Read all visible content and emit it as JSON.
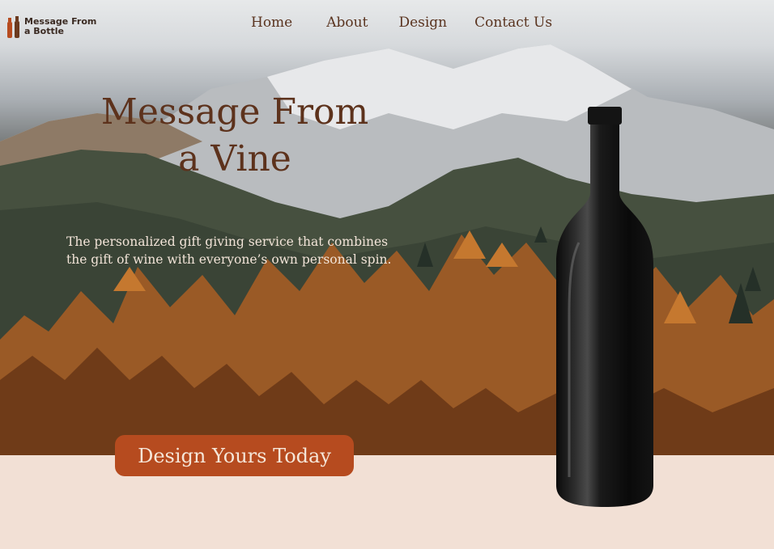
{
  "brand": {
    "name": "Message From a Bottle",
    "line1": "Message From",
    "line2": "a Bottle"
  },
  "nav": {
    "home": "Home",
    "about": "About",
    "design": "Design",
    "contact": "Contact Us"
  },
  "hero": {
    "headline_line1": "Message From",
    "headline_line2": "a Vine",
    "tagline": "The personalized gift giving service that combines the gift of wine with everyone’s own personal spin.",
    "cta_label": "Design Yours Today"
  },
  "colors": {
    "accent": "#b64b1f",
    "headline": "#5d321c",
    "footer_bg": "#f2e0d5"
  },
  "icons": {
    "logo": "wine-bottles-icon",
    "product": "wine-bottle-icon"
  }
}
